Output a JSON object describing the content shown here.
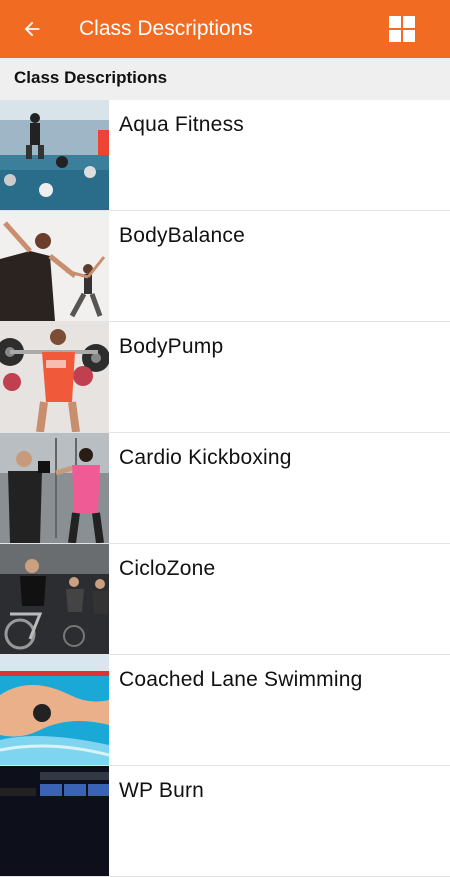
{
  "appbar": {
    "title": "Class Descriptions",
    "back_icon": "arrow-back-icon",
    "grid_icon": "grid-view-icon",
    "color": "#f26b22"
  },
  "section": {
    "header": "Class Descriptions"
  },
  "classes": [
    {
      "name": "Aqua Fitness"
    },
    {
      "name": "BodyBalance"
    },
    {
      "name": "BodyPump"
    },
    {
      "name": "Cardio Kickboxing"
    },
    {
      "name": "CicloZone"
    },
    {
      "name": "Coached Lane Swimming"
    },
    {
      "name": "WP Burn"
    }
  ]
}
